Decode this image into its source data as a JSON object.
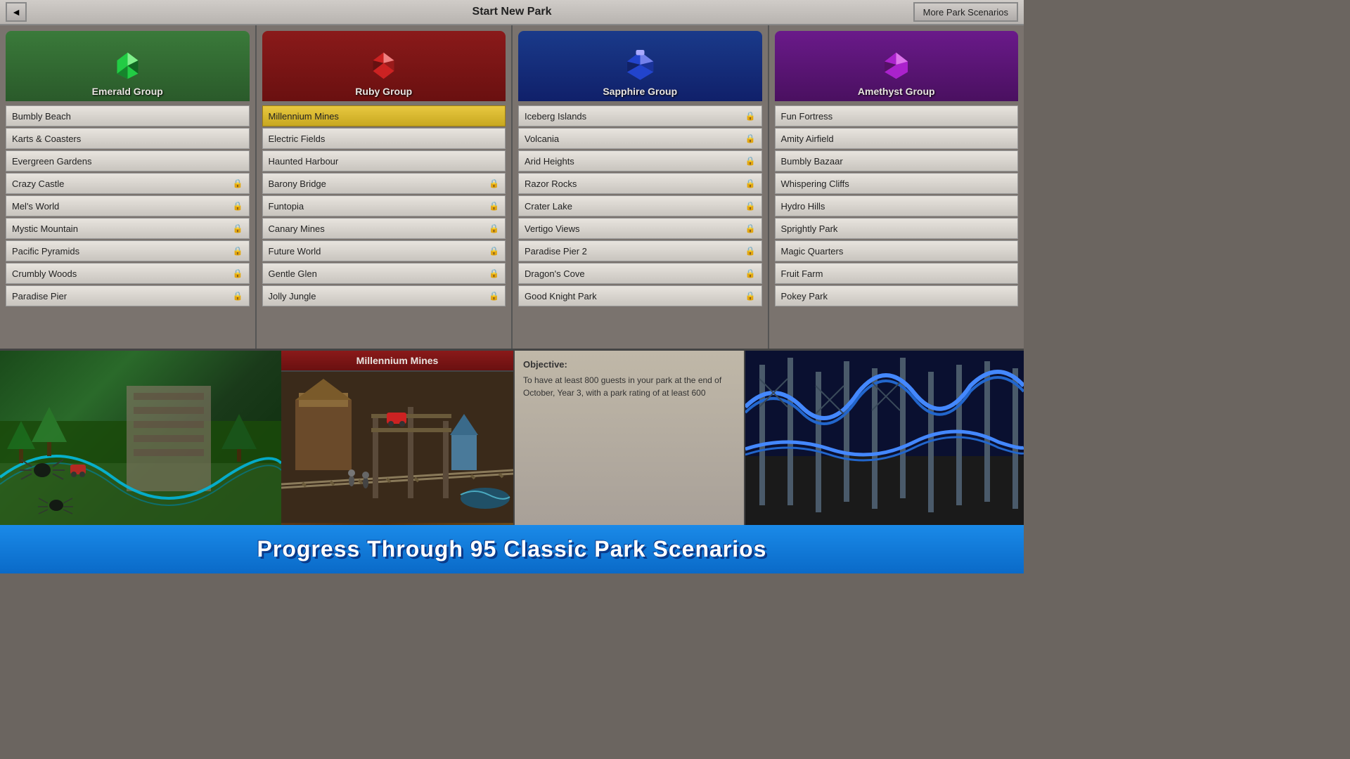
{
  "titleBar": {
    "title": "Start New Park",
    "backBtn": "◄",
    "moreScenariosBtn": "More Park Scenarios"
  },
  "groups": [
    {
      "id": "emerald",
      "name": "Emerald Group",
      "colorClass": "group-emerald",
      "gemColor1": "#aaffaa",
      "gemColor2": "#22cc44",
      "gemColor3": "#116622",
      "scenarios": [
        {
          "name": "Bumbly Beach",
          "locked": false
        },
        {
          "name": "Karts & Coasters",
          "locked": false
        },
        {
          "name": "Evergreen Gardens",
          "locked": false
        },
        {
          "name": "Crazy Castle",
          "locked": true
        },
        {
          "name": "Mel's World",
          "locked": true
        },
        {
          "name": "Mystic Mountain",
          "locked": true
        },
        {
          "name": "Pacific Pyramids",
          "locked": true
        },
        {
          "name": "Crumbly Woods",
          "locked": true
        },
        {
          "name": "Paradise Pier",
          "locked": true
        }
      ]
    },
    {
      "id": "ruby",
      "name": "Ruby Group",
      "colorClass": "group-ruby",
      "gemColor1": "#ffaaaa",
      "gemColor2": "#cc2222",
      "gemColor3": "#661111",
      "scenarios": [
        {
          "name": "Millennium Mines",
          "locked": false,
          "selected": true
        },
        {
          "name": "Electric Fields",
          "locked": false
        },
        {
          "name": "Haunted Harbour",
          "locked": false
        },
        {
          "name": "Barony Bridge",
          "locked": true
        },
        {
          "name": "Funtopia",
          "locked": true
        },
        {
          "name": "Canary Mines",
          "locked": true
        },
        {
          "name": "Future World",
          "locked": true
        },
        {
          "name": "Gentle Glen",
          "locked": true
        },
        {
          "name": "Jolly Jungle",
          "locked": true
        }
      ]
    },
    {
      "id": "sapphire",
      "name": "Sapphire Group",
      "colorClass": "group-sapphire",
      "gemColor1": "#aaaaff",
      "gemColor2": "#2244cc",
      "gemColor3": "#112266",
      "scenarios": [
        {
          "name": "Iceberg Islands",
          "locked": true
        },
        {
          "name": "Volcania",
          "locked": true
        },
        {
          "name": "Arid Heights",
          "locked": true
        },
        {
          "name": "Razor Rocks",
          "locked": true
        },
        {
          "name": "Crater Lake",
          "locked": true
        },
        {
          "name": "Vertigo Views",
          "locked": true
        },
        {
          "name": "Paradise Pier 2",
          "locked": true
        },
        {
          "name": "Dragon's Cove",
          "locked": true
        },
        {
          "name": "Good Knight Park",
          "locked": true
        }
      ]
    },
    {
      "id": "amethyst",
      "name": "Amethyst Group",
      "colorClass": "group-amethyst",
      "gemColor1": "#ffaaff",
      "gemColor2": "#aa22cc",
      "gemColor3": "#551166",
      "scenarios": [
        {
          "name": "Fun Fortress",
          "locked": false
        },
        {
          "name": "Amity Airfield",
          "locked": false
        },
        {
          "name": "Bumbly Bazaar",
          "locked": false
        },
        {
          "name": "Whispering Cliffs",
          "locked": false
        },
        {
          "name": "Hydro Hills",
          "locked": false
        },
        {
          "name": "Sprightly Park",
          "locked": false
        },
        {
          "name": "Magic Quarters",
          "locked": false
        },
        {
          "name": "Fruit Farm",
          "locked": false
        },
        {
          "name": "Pokey Park",
          "locked": false
        }
      ]
    }
  ],
  "preview": {
    "title": "Millennium Mines",
    "objective": {
      "label": "Objective:",
      "text": "To have at least 800 guests in your park at the end of October, Year 3, with a park rating of at least 600"
    }
  },
  "banner": {
    "text": "Progress Through 95 Classic Park Scenarios"
  }
}
